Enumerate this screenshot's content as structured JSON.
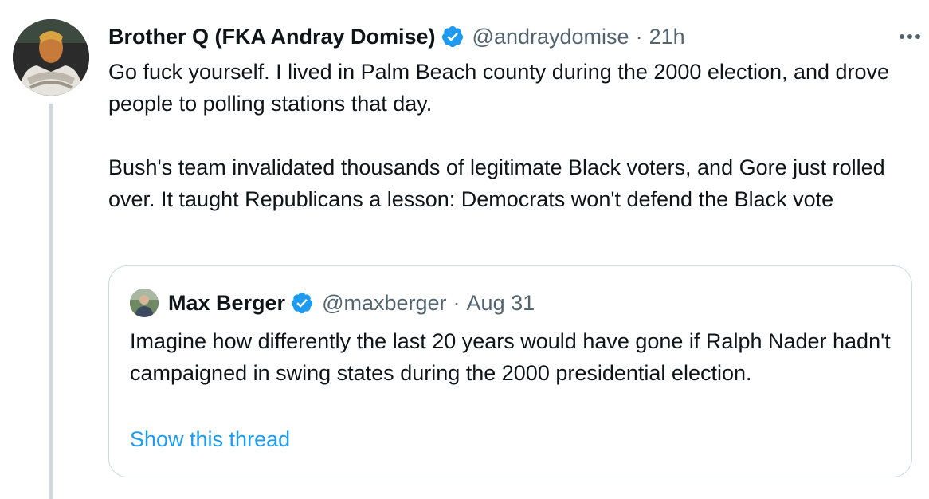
{
  "tweet": {
    "author": {
      "display_name": "Brother Q (FKA Andray Domise)",
      "handle": "@andraydomise",
      "separator": "·",
      "time": "21h",
      "verified": true
    },
    "text_paragraphs": [
      "Go fuck yourself. I lived in Palm Beach county during the 2000 election, and drove people to polling stations that day.",
      "Bush's team invalidated thousands of legitimate Black voters, and Gore just rolled over. It taught Republicans a lesson: Democrats won't defend the Black vote"
    ],
    "more_icon": "more-horizontal-icon"
  },
  "quote": {
    "author": {
      "display_name": "Max Berger",
      "handle": "@maxberger",
      "separator": "·",
      "time": "Aug 31",
      "verified": true
    },
    "text": "Imagine how differently the last 20 years would have gone if Ralph Nader hadn't campaigned in swing states during the 2000 presidential election.",
    "show_thread_label": "Show this thread"
  },
  "colors": {
    "text_primary": "#0f1419",
    "text_secondary": "#536471",
    "link": "#1d9bf0",
    "verified_badge": "#1d9bf0",
    "border": "#cfd9de"
  }
}
